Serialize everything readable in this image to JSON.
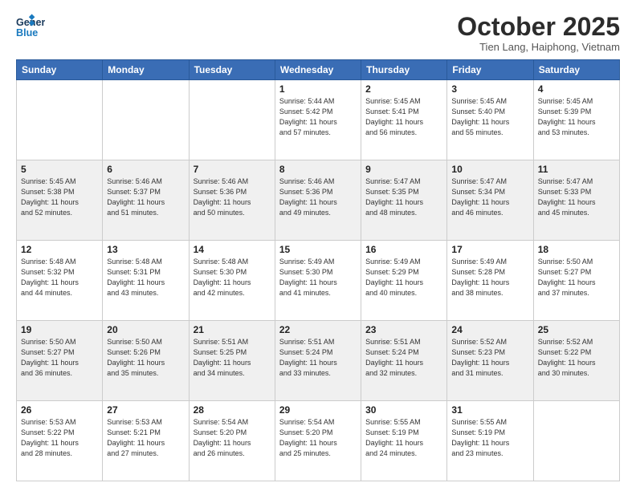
{
  "header": {
    "logo_line1": "General",
    "logo_line2": "Blue",
    "month_title": "October 2025",
    "location": "Tien Lang, Haiphong, Vietnam"
  },
  "weekdays": [
    "Sunday",
    "Monday",
    "Tuesday",
    "Wednesday",
    "Thursday",
    "Friday",
    "Saturday"
  ],
  "weeks": [
    [
      {
        "day": "",
        "info": ""
      },
      {
        "day": "",
        "info": ""
      },
      {
        "day": "",
        "info": ""
      },
      {
        "day": "1",
        "info": "Sunrise: 5:44 AM\nSunset: 5:42 PM\nDaylight: 11 hours\nand 57 minutes."
      },
      {
        "day": "2",
        "info": "Sunrise: 5:45 AM\nSunset: 5:41 PM\nDaylight: 11 hours\nand 56 minutes."
      },
      {
        "day": "3",
        "info": "Sunrise: 5:45 AM\nSunset: 5:40 PM\nDaylight: 11 hours\nand 55 minutes."
      },
      {
        "day": "4",
        "info": "Sunrise: 5:45 AM\nSunset: 5:39 PM\nDaylight: 11 hours\nand 53 minutes."
      }
    ],
    [
      {
        "day": "5",
        "info": "Sunrise: 5:45 AM\nSunset: 5:38 PM\nDaylight: 11 hours\nand 52 minutes."
      },
      {
        "day": "6",
        "info": "Sunrise: 5:46 AM\nSunset: 5:37 PM\nDaylight: 11 hours\nand 51 minutes."
      },
      {
        "day": "7",
        "info": "Sunrise: 5:46 AM\nSunset: 5:36 PM\nDaylight: 11 hours\nand 50 minutes."
      },
      {
        "day": "8",
        "info": "Sunrise: 5:46 AM\nSunset: 5:36 PM\nDaylight: 11 hours\nand 49 minutes."
      },
      {
        "day": "9",
        "info": "Sunrise: 5:47 AM\nSunset: 5:35 PM\nDaylight: 11 hours\nand 48 minutes."
      },
      {
        "day": "10",
        "info": "Sunrise: 5:47 AM\nSunset: 5:34 PM\nDaylight: 11 hours\nand 46 minutes."
      },
      {
        "day": "11",
        "info": "Sunrise: 5:47 AM\nSunset: 5:33 PM\nDaylight: 11 hours\nand 45 minutes."
      }
    ],
    [
      {
        "day": "12",
        "info": "Sunrise: 5:48 AM\nSunset: 5:32 PM\nDaylight: 11 hours\nand 44 minutes."
      },
      {
        "day": "13",
        "info": "Sunrise: 5:48 AM\nSunset: 5:31 PM\nDaylight: 11 hours\nand 43 minutes."
      },
      {
        "day": "14",
        "info": "Sunrise: 5:48 AM\nSunset: 5:30 PM\nDaylight: 11 hours\nand 42 minutes."
      },
      {
        "day": "15",
        "info": "Sunrise: 5:49 AM\nSunset: 5:30 PM\nDaylight: 11 hours\nand 41 minutes."
      },
      {
        "day": "16",
        "info": "Sunrise: 5:49 AM\nSunset: 5:29 PM\nDaylight: 11 hours\nand 40 minutes."
      },
      {
        "day": "17",
        "info": "Sunrise: 5:49 AM\nSunset: 5:28 PM\nDaylight: 11 hours\nand 38 minutes."
      },
      {
        "day": "18",
        "info": "Sunrise: 5:50 AM\nSunset: 5:27 PM\nDaylight: 11 hours\nand 37 minutes."
      }
    ],
    [
      {
        "day": "19",
        "info": "Sunrise: 5:50 AM\nSunset: 5:27 PM\nDaylight: 11 hours\nand 36 minutes."
      },
      {
        "day": "20",
        "info": "Sunrise: 5:50 AM\nSunset: 5:26 PM\nDaylight: 11 hours\nand 35 minutes."
      },
      {
        "day": "21",
        "info": "Sunrise: 5:51 AM\nSunset: 5:25 PM\nDaylight: 11 hours\nand 34 minutes."
      },
      {
        "day": "22",
        "info": "Sunrise: 5:51 AM\nSunset: 5:24 PM\nDaylight: 11 hours\nand 33 minutes."
      },
      {
        "day": "23",
        "info": "Sunrise: 5:51 AM\nSunset: 5:24 PM\nDaylight: 11 hours\nand 32 minutes."
      },
      {
        "day": "24",
        "info": "Sunrise: 5:52 AM\nSunset: 5:23 PM\nDaylight: 11 hours\nand 31 minutes."
      },
      {
        "day": "25",
        "info": "Sunrise: 5:52 AM\nSunset: 5:22 PM\nDaylight: 11 hours\nand 30 minutes."
      }
    ],
    [
      {
        "day": "26",
        "info": "Sunrise: 5:53 AM\nSunset: 5:22 PM\nDaylight: 11 hours\nand 28 minutes."
      },
      {
        "day": "27",
        "info": "Sunrise: 5:53 AM\nSunset: 5:21 PM\nDaylight: 11 hours\nand 27 minutes."
      },
      {
        "day": "28",
        "info": "Sunrise: 5:54 AM\nSunset: 5:20 PM\nDaylight: 11 hours\nand 26 minutes."
      },
      {
        "day": "29",
        "info": "Sunrise: 5:54 AM\nSunset: 5:20 PM\nDaylight: 11 hours\nand 25 minutes."
      },
      {
        "day": "30",
        "info": "Sunrise: 5:55 AM\nSunset: 5:19 PM\nDaylight: 11 hours\nand 24 minutes."
      },
      {
        "day": "31",
        "info": "Sunrise: 5:55 AM\nSunset: 5:19 PM\nDaylight: 11 hours\nand 23 minutes."
      },
      {
        "day": "",
        "info": ""
      }
    ]
  ],
  "colors": {
    "header_bg": "#3a6db5",
    "row_shaded": "#f0f0f0",
    "row_white": "#ffffff"
  }
}
